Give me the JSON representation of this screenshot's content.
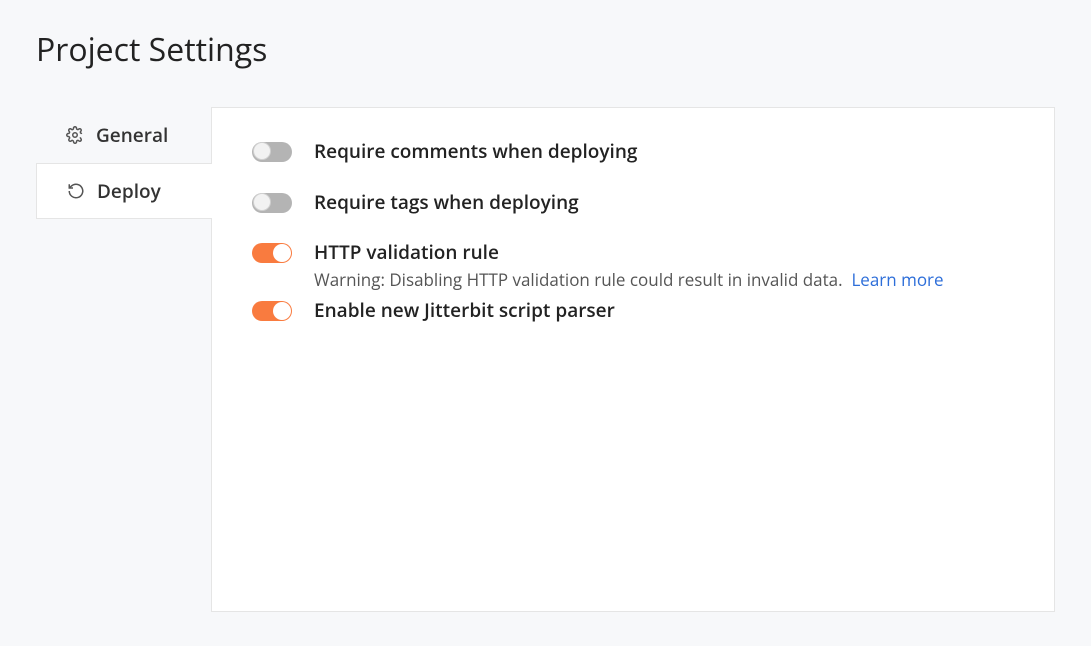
{
  "page": {
    "title": "Project Settings"
  },
  "sidebar": {
    "tabs": [
      {
        "label": "General",
        "icon": "gear-icon",
        "active": false
      },
      {
        "label": "Deploy",
        "icon": "refresh-icon",
        "active": true
      }
    ]
  },
  "settings": [
    {
      "label": "Require comments when deploying",
      "enabled": false
    },
    {
      "label": "Require tags when deploying",
      "enabled": false
    },
    {
      "label": "HTTP validation rule",
      "enabled": true,
      "description": "Warning: Disabling HTTP validation rule could result in invalid data.",
      "link_text": "Learn more"
    },
    {
      "label": "Enable new Jitterbit script parser",
      "enabled": true
    }
  ]
}
